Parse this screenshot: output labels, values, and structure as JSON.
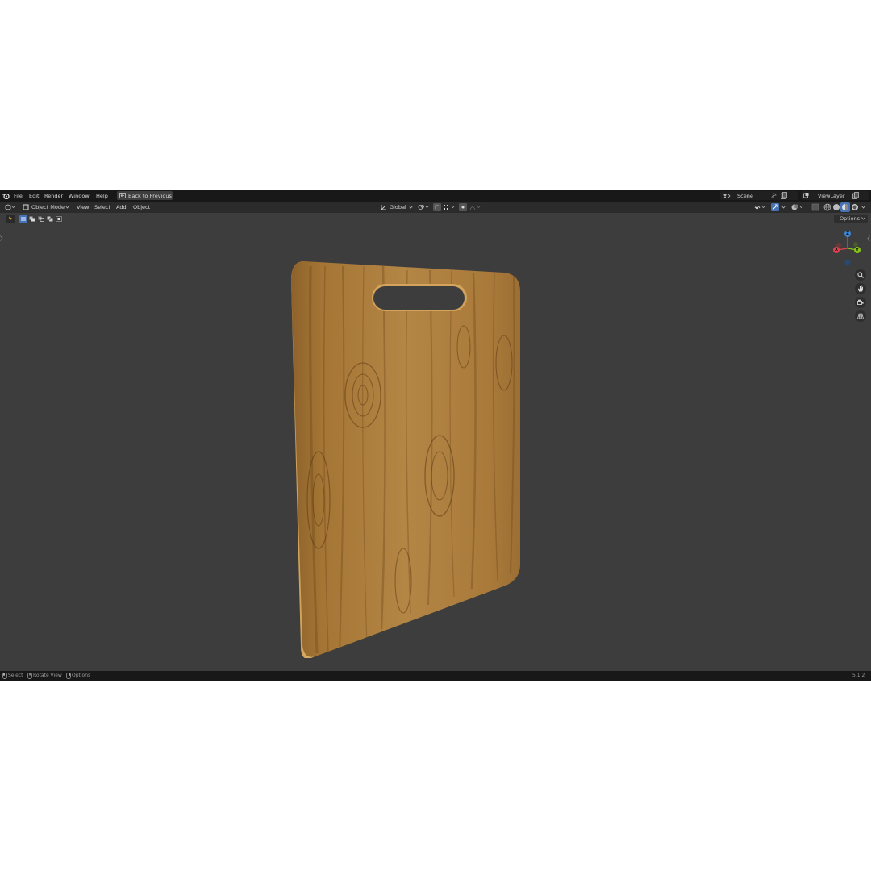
{
  "topbar": {
    "menus": [
      "File",
      "Edit",
      "Render",
      "Window",
      "Help"
    ],
    "back_button": "Back to Previous",
    "scene": "Scene",
    "view_layer": "ViewLayer"
  },
  "header": {
    "mode": "Object Mode",
    "menus": [
      "View",
      "Select",
      "Add",
      "Object"
    ],
    "transform_orientation": "Global"
  },
  "toolbar": {
    "options_label": "Options"
  },
  "gizmo": {
    "axes": [
      "Z",
      "X",
      "Y"
    ]
  },
  "status": {
    "items": [
      "Select",
      "Rotate View",
      "Options"
    ],
    "version": "5.1.2"
  },
  "colors": {
    "background": "#3d3d3d",
    "topbar": "#181818",
    "header": "#2b2b2b",
    "axis_x": "#e0424f",
    "axis_y": "#85c21b",
    "axis_z": "#3c86d8",
    "wood": "#a47534"
  },
  "icons": [
    "blender-logo-icon",
    "editor-type-icon",
    "object-mode-icon",
    "transform-orientation-icon",
    "snap-icon",
    "proportional-edit-icon",
    "gizmo-icon",
    "overlay-icon",
    "xray-icon",
    "wireframe-shading-icon",
    "solid-shading-icon",
    "material-shading-icon",
    "rendered-shading-icon",
    "zoom-icon",
    "pan-hand-icon",
    "camera-view-icon",
    "grid-perspective-icon",
    "select-tool-icon",
    "mouse-left-icon",
    "mouse-middle-icon",
    "mouse-right-icon"
  ]
}
